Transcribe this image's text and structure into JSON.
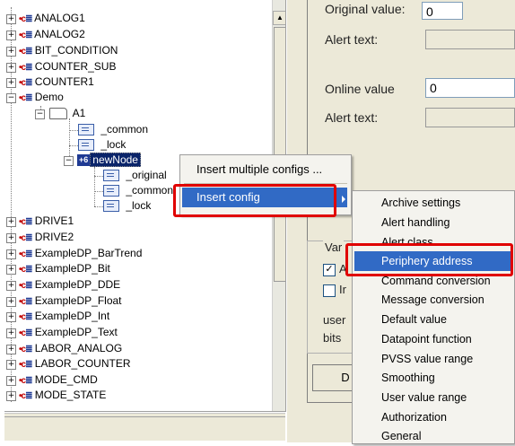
{
  "tree": {
    "items": [
      {
        "label": "ANALOG1",
        "expander": "+"
      },
      {
        "label": "ANALOG2",
        "expander": "+"
      },
      {
        "label": "BIT_CONDITION",
        "expander": "+"
      },
      {
        "label": "COUNTER_SUB",
        "expander": "+"
      },
      {
        "label": "COUNTER1",
        "expander": "+"
      },
      {
        "label": "Demo",
        "expander": "−"
      },
      {
        "label": "DRIVE1",
        "expander": "+"
      },
      {
        "label": "DRIVE2",
        "expander": "+"
      },
      {
        "label": "ExampleDP_BarTrend",
        "expander": "+"
      },
      {
        "label": "ExampleDP_Bit",
        "expander": "+"
      },
      {
        "label": "ExampleDP_DDE",
        "expander": "+"
      },
      {
        "label": "ExampleDP_Float",
        "expander": "+"
      },
      {
        "label": "ExampleDP_Int",
        "expander": "+"
      },
      {
        "label": "ExampleDP_Text",
        "expander": "+"
      },
      {
        "label": "LABOR_ANALOG",
        "expander": "+"
      },
      {
        "label": "LABOR_COUNTER",
        "expander": "+"
      },
      {
        "label": "MODE_CMD",
        "expander": "+"
      },
      {
        "label": "MODE_STATE",
        "expander": "+"
      }
    ],
    "folder_a1": "A1",
    "common": "_common",
    "lock": "_lock",
    "new_node": "newNode",
    "new_node_badge": "+6",
    "sub_original": "_original",
    "sub_common": "_common",
    "sub_lock": "_lock",
    "dp_icon_text": "•c",
    "dp_icon_mark": "≣"
  },
  "right": {
    "original_value_label": "Original value:",
    "original_value": "0",
    "alert_text_label_1": "Alert text:",
    "online_value_label": "Online value",
    "online_value": "0",
    "alert_text_label_2": "Alert text:",
    "group_label": "Var",
    "chk1_label": "A",
    "chk1_mark": "✓",
    "chk2_label": "Ir",
    "user_text": "user",
    "bits_text": "bits",
    "button_d": "D"
  },
  "menu1": {
    "item1": "Insert multiple configs ...",
    "item2": "Insert config"
  },
  "menu2": {
    "items": [
      "Archive settings",
      "Alert handling",
      "Alert class",
      "Periphery address",
      "Command conversion",
      "Message conversion",
      "Default value",
      "Datapoint function",
      "PVSS value range",
      "Smoothing",
      "User value range",
      "Authorization",
      "General"
    ],
    "highlighted_index": 3
  },
  "colors": {
    "highlight": "#316ac5",
    "annotation_red": "#e00000"
  }
}
